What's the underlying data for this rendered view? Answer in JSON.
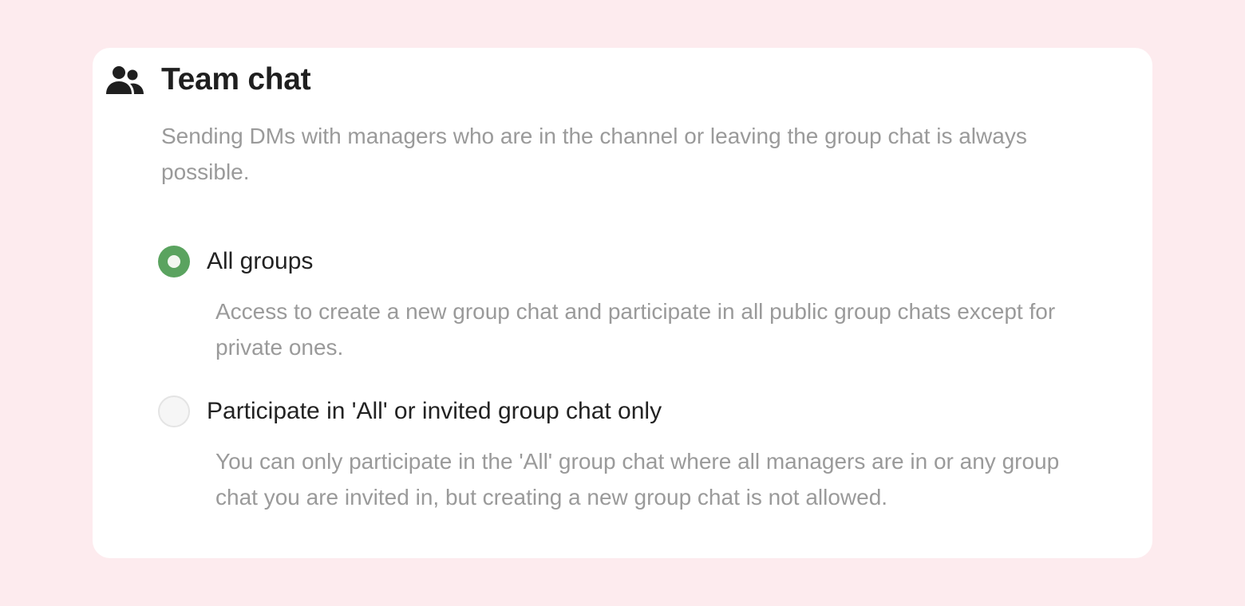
{
  "section": {
    "icon": "users-icon",
    "title": "Team chat",
    "description": "Sending DMs with managers who are in the channel or leaving the group chat is always possible."
  },
  "options": [
    {
      "label": "All groups",
      "description": "Access to create a new group chat and participate in all public group chats except for private ones.",
      "selected": true
    },
    {
      "label": "Participate in 'All' or invited group chat only",
      "description": "You can only participate in the 'All' group chat where all managers are in or any group chat you are invited in, but creating a new group chat is not allowed.",
      "selected": false
    }
  ],
  "colors": {
    "background": "#fdebee",
    "card": "#ffffff",
    "accent": "#5aa35f",
    "title": "#1f1f1f",
    "muted_text": "#9a9a9a"
  }
}
